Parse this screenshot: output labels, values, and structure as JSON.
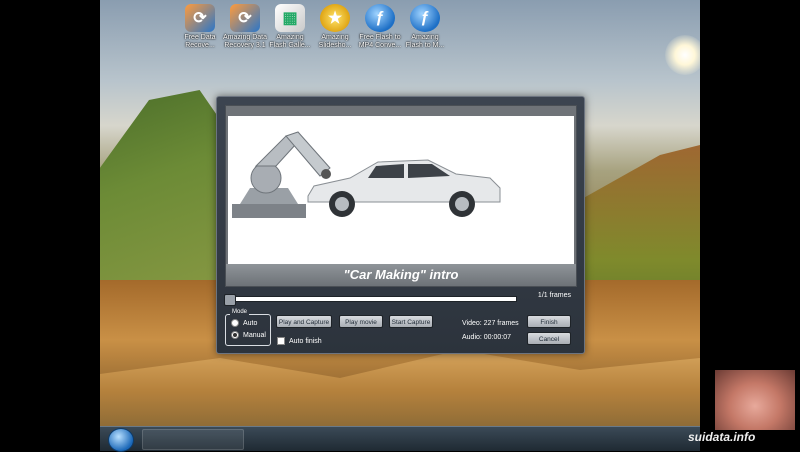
{
  "desktop": {
    "icons": [
      {
        "icon": "recovery-icon",
        "label": "Free Data\nRecove..."
      },
      {
        "icon": "recovery-icon",
        "label": "Amazing Data\nRecovery 3.1"
      },
      {
        "icon": "gallery-icon",
        "label": "Amazing\nFlash Galle..."
      },
      {
        "icon": "slideshow-icon",
        "label": "Amazing\nSlidesho..."
      },
      {
        "icon": "flash-icon",
        "label": "Free Flash to\nMP4 Conve..."
      },
      {
        "icon": "flash-icon",
        "label": "Amazing\nFlash to M..."
      }
    ]
  },
  "dialog": {
    "preview_title": "\"Car Making\" intro",
    "progress": {
      "value": 1,
      "max": 1
    },
    "frames_label": "1/1 frames",
    "mode_legend": "Mode",
    "mode_options": [
      "Auto",
      "Manual"
    ],
    "mode_selected": "Manual",
    "buttons": {
      "play_capture": "Play and Capture",
      "play_movie": "Play movie",
      "start_capture": "Start Capture",
      "finish": "Finish",
      "cancel": "Cancel"
    },
    "auto_finish": "Auto finish",
    "video_info": "Video: 227 frames",
    "audio_info": "Audio: 00:00:07"
  },
  "watermark": "suidata.info"
}
